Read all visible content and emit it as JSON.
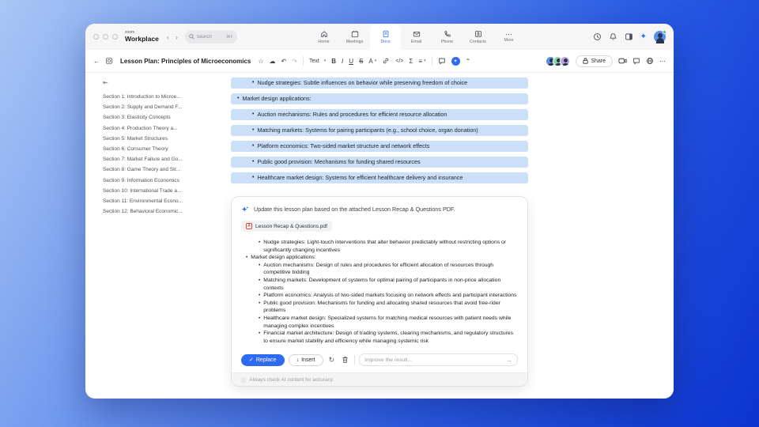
{
  "colors": {
    "accent_blue": "#2f6bf2",
    "highlight_blue": "#cbdff9",
    "background_gradient": [
      "#aac6f5",
      "#0c33cf"
    ],
    "pdf_red": "#e0443a",
    "status_green": "#3ec463",
    "mini_avatar_colors": [
      "#5b8def",
      "#8fd6a8",
      "#b9a7e6"
    ]
  },
  "icons_text": {
    "nav_back": "‹",
    "nav_forward": "›",
    "shortcut": "⌘F",
    "back_arrow": "←",
    "star": "☆",
    "cloud": "☁",
    "undo": "↶",
    "redo": "↷",
    "bold": "B",
    "italic": "I",
    "underline": "U",
    "strike": "S",
    "text_color": "A",
    "code": "</>",
    "sigma": "Σ",
    "align": "≡",
    "collapse": "⌃",
    "more_dots": "⋯",
    "collapse_sidebar": "⇤",
    "check": "✓",
    "insert_down": "↓",
    "refresh": "↻",
    "send_arrow": "→",
    "info": "ⓘ",
    "ai_sparkle": "✦",
    "pdf_letter": "A"
  },
  "titlebar": {
    "logo_top": "zoom",
    "logo_bottom": "Workplace",
    "search_placeholder": "Search",
    "tabs": [
      {
        "label": "Home"
      },
      {
        "label": "Meetings"
      },
      {
        "label": "Docs",
        "active": true
      },
      {
        "label": "Email"
      },
      {
        "label": "Phone"
      },
      {
        "label": "Contacts"
      },
      {
        "label": "More"
      }
    ]
  },
  "toolbar": {
    "doc_title": "Lesson Plan: Principles of Microeconomics",
    "text_style_label": "Text",
    "share_label": "Share"
  },
  "sidebar": {
    "sections": [
      "Section 1: Introduction to Microe...",
      "Section 2: Supply and Demand F...",
      "Section 3: Elasticity Concepts",
      "Section 4: Production Theory a...",
      "Section 5: Market Structures",
      "Section 6: Consumer Theory",
      "Section 7: Market Failure and Go...",
      "Section 8: Game Theory and Str...",
      "Section 9: Information Economics",
      "Section 10: International Trade a...",
      "Section 11: Environmental Econo...",
      "Section 12: Behavioral Economic..."
    ]
  },
  "document": {
    "highlighted_lines": [
      {
        "indent": 2,
        "text": "Nudge strategies: Subtle influences on behavior while preserving freedom of choice"
      },
      {
        "indent": 1,
        "text": "Market design applications:"
      },
      {
        "indent": 2,
        "text": "Auction mechanisms: Rules and procedures for efficient resource allocation"
      },
      {
        "indent": 2,
        "text": "Matching markets: Systems for pairing participants (e.g., school choice, organ donation)"
      },
      {
        "indent": 2,
        "text": "Platform economics: Two-sided market structure and network effects"
      },
      {
        "indent": 2,
        "text": "Public good provision: Mechanisms for funding shared resources"
      },
      {
        "indent": 2,
        "text": "Healthcare market design: Systems for efficient healthcare delivery and insurance"
      }
    ]
  },
  "ai_panel": {
    "prompt": "Update this lesson plan based on the attached Lesson Recap & Questions PDF.",
    "attachment_name": "Lesson Recap & Questions.pdf",
    "bullets": [
      {
        "indent": 2,
        "text": "Nudge strategies: Light-touch interventions that alter behavior predictably without restricting options or significantly changing incentives"
      },
      {
        "indent": 1,
        "text": "Market design applications:"
      },
      {
        "indent": 2,
        "text": "Auction mechanisms: Design of rules and procedures for efficient allocation of resources through competitive bidding"
      },
      {
        "indent": 2,
        "text": "Matching markets: Development of systems for optimal pairing of participants in non-price allocation contexts"
      },
      {
        "indent": 2,
        "text": "Platform economics: Analysis of two-sided markets focusing on network effects and participant interactions"
      },
      {
        "indent": 2,
        "text": "Public good provision: Mechanisms for funding and allocating shared resources that avoid free-rider problems"
      },
      {
        "indent": 2,
        "text": "Healthcare market design: Specialized systems for matching medical resources with patient needs while managing complex incentives"
      },
      {
        "indent": 2,
        "text": "Financial market architecture: Design of trading systems, clearing mechanisms, and regulatory structures to ensure market stability and efficiency while managing systemic risk"
      }
    ],
    "replace_label": "Replace",
    "insert_label": "Insert",
    "improve_placeholder": "Improve the result...",
    "footer_note": "Always check AI content for accuracy."
  }
}
